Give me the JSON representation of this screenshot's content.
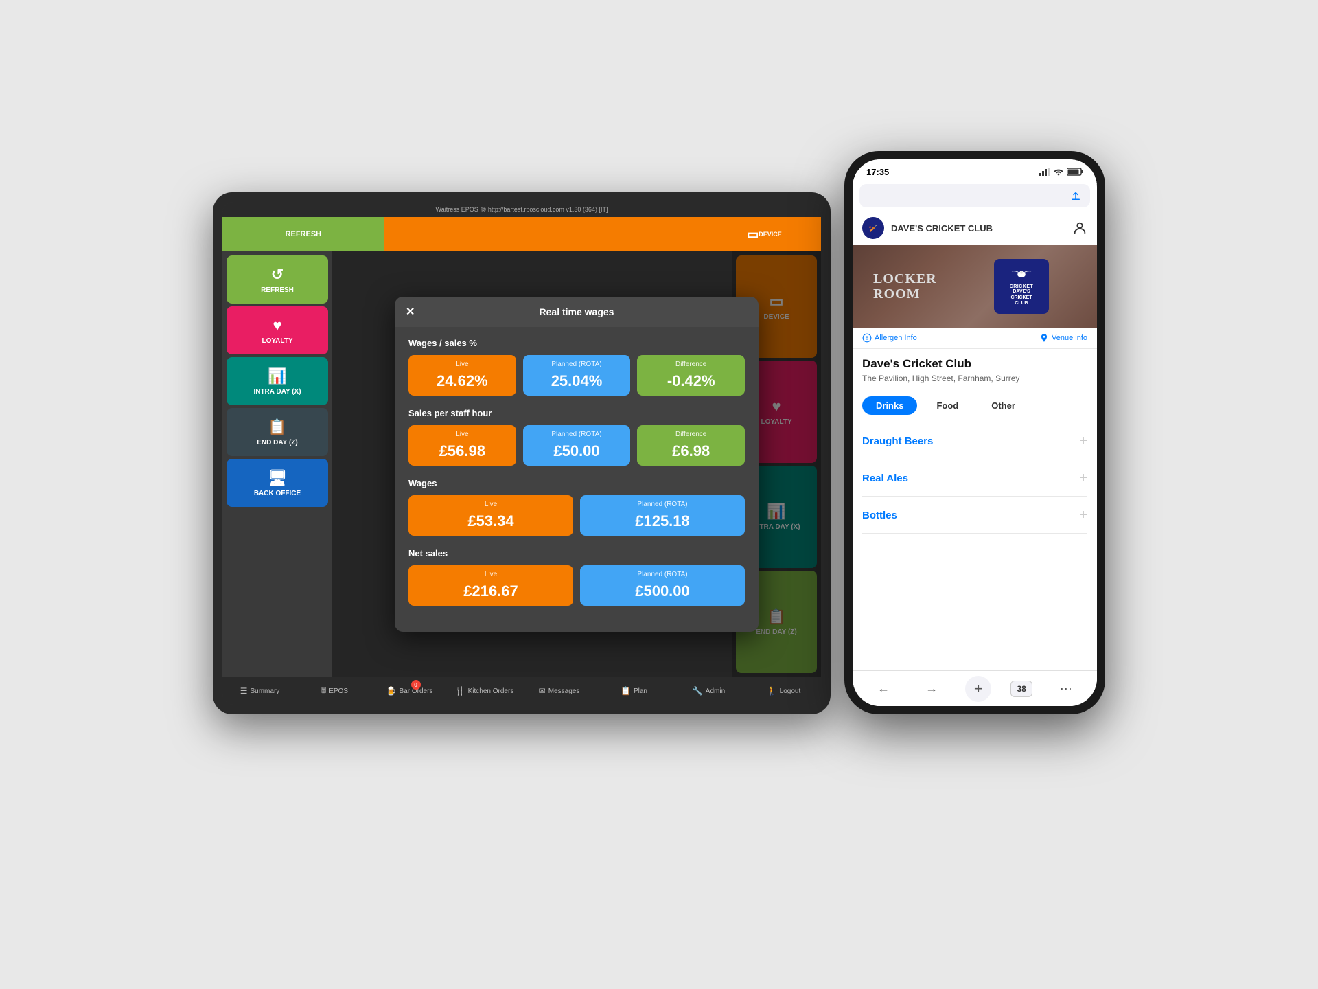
{
  "tablet": {
    "top_bar_text": "Waitress EPOS @ http://bartest.rposcloud.com    v1.30 (364) [IT]",
    "nav_buttons": [
      {
        "label": "REFRESH",
        "style": "green"
      },
      {
        "label": "",
        "style": "orange"
      },
      {
        "label": "",
        "style": "orange"
      },
      {
        "label": "DEVICE",
        "style": "orange",
        "has_icon": true
      }
    ],
    "sidebar_buttons": [
      {
        "label": "REFRESH",
        "style": "green",
        "icon": "↺"
      },
      {
        "label": "LOYALTY",
        "style": "pink",
        "icon": "♥"
      },
      {
        "label": "INTRA DAY (X)",
        "style": "teal",
        "icon": "📊"
      },
      {
        "label": "END DAY (Z)",
        "style": "purple",
        "icon": "📋"
      },
      {
        "label": "BACK OFFICE",
        "style": "blue",
        "icon": "🖥"
      }
    ],
    "right_buttons": [
      {
        "label": "DEVICE",
        "style": "orange",
        "icon": "▭"
      },
      {
        "label": "LOYALTY",
        "style": "pink",
        "icon": "♥"
      },
      {
        "label": "INTRA DAY (X)",
        "style": "teal",
        "icon": "📊"
      },
      {
        "label": "END DAY (Z)",
        "style": "green",
        "icon": "📋"
      }
    ],
    "bottom_nav": [
      {
        "label": "Summary",
        "icon": "☰",
        "badge": null
      },
      {
        "label": "EPOS",
        "icon": "🖩",
        "badge": null
      },
      {
        "label": "Bar Orders",
        "icon": "🍺",
        "badge": "0"
      },
      {
        "label": "Kitchen Orders",
        "icon": "🍴",
        "badge": null
      },
      {
        "label": "Messages",
        "icon": "✉",
        "badge": null
      },
      {
        "label": "Plan",
        "icon": "📋",
        "badge": null
      },
      {
        "label": "Admin",
        "icon": "🔧",
        "badge": null
      },
      {
        "label": "Logout",
        "icon": "🚶",
        "badge": null
      }
    ],
    "modal": {
      "title": "Real time wages",
      "close_label": "✕",
      "sections": [
        {
          "title": "Wages / sales %",
          "metrics": [
            {
              "label": "Live",
              "value": "24.62%",
              "style": "orange"
            },
            {
              "label": "Planned (ROTA)",
              "value": "25.04%",
              "style": "blue"
            },
            {
              "label": "Difference",
              "value": "-0.42%",
              "style": "green"
            }
          ]
        },
        {
          "title": "Sales per staff hour",
          "metrics": [
            {
              "label": "Live",
              "value": "£56.98",
              "style": "orange"
            },
            {
              "label": "Planned (ROTA)",
              "value": "£50.00",
              "style": "blue"
            },
            {
              "label": "Difference",
              "value": "£6.98",
              "style": "green"
            }
          ]
        },
        {
          "title": "Wages",
          "metrics": [
            {
              "label": "Live",
              "value": "£53.34",
              "style": "orange"
            },
            {
              "label": "Planned (ROTA)",
              "value": "£125.18",
              "style": "blue"
            }
          ]
        },
        {
          "title": "Net sales",
          "metrics": [
            {
              "label": "Live",
              "value": "£216.67",
              "style": "orange"
            },
            {
              "label": "Planned (ROTA)",
              "value": "£500.00",
              "style": "blue"
            }
          ]
        }
      ]
    }
  },
  "phone": {
    "status_time": "17:35",
    "status_right": "▲ ◆ ◆",
    "address_bar": "",
    "venue_bar_name": "DAVE'S CRICKET CLUB",
    "locker_room_text": "LOCKER\nROOM",
    "venue_logo_text": "DAVE'S CRICKET CLUB",
    "venue_logo_badge": "CRICKET",
    "allergen_label": "Allergen Info",
    "venue_info_label": "Venue info",
    "venue_title": "Dave's Cricket Club",
    "venue_address": "The Pavilion, High Street, Farnham, Surrey",
    "tabs": [
      {
        "label": "Drinks",
        "active": true
      },
      {
        "label": "Food",
        "active": false
      },
      {
        "label": "Other",
        "active": false
      }
    ],
    "menu_categories": [
      {
        "name": "Draught Beers"
      },
      {
        "name": "Real Ales"
      },
      {
        "name": "Bottles"
      }
    ],
    "bottom_bar": [
      {
        "label": "←"
      },
      {
        "label": "→"
      },
      {
        "label": "+"
      },
      {
        "label": "38"
      },
      {
        "label": "···"
      }
    ]
  }
}
